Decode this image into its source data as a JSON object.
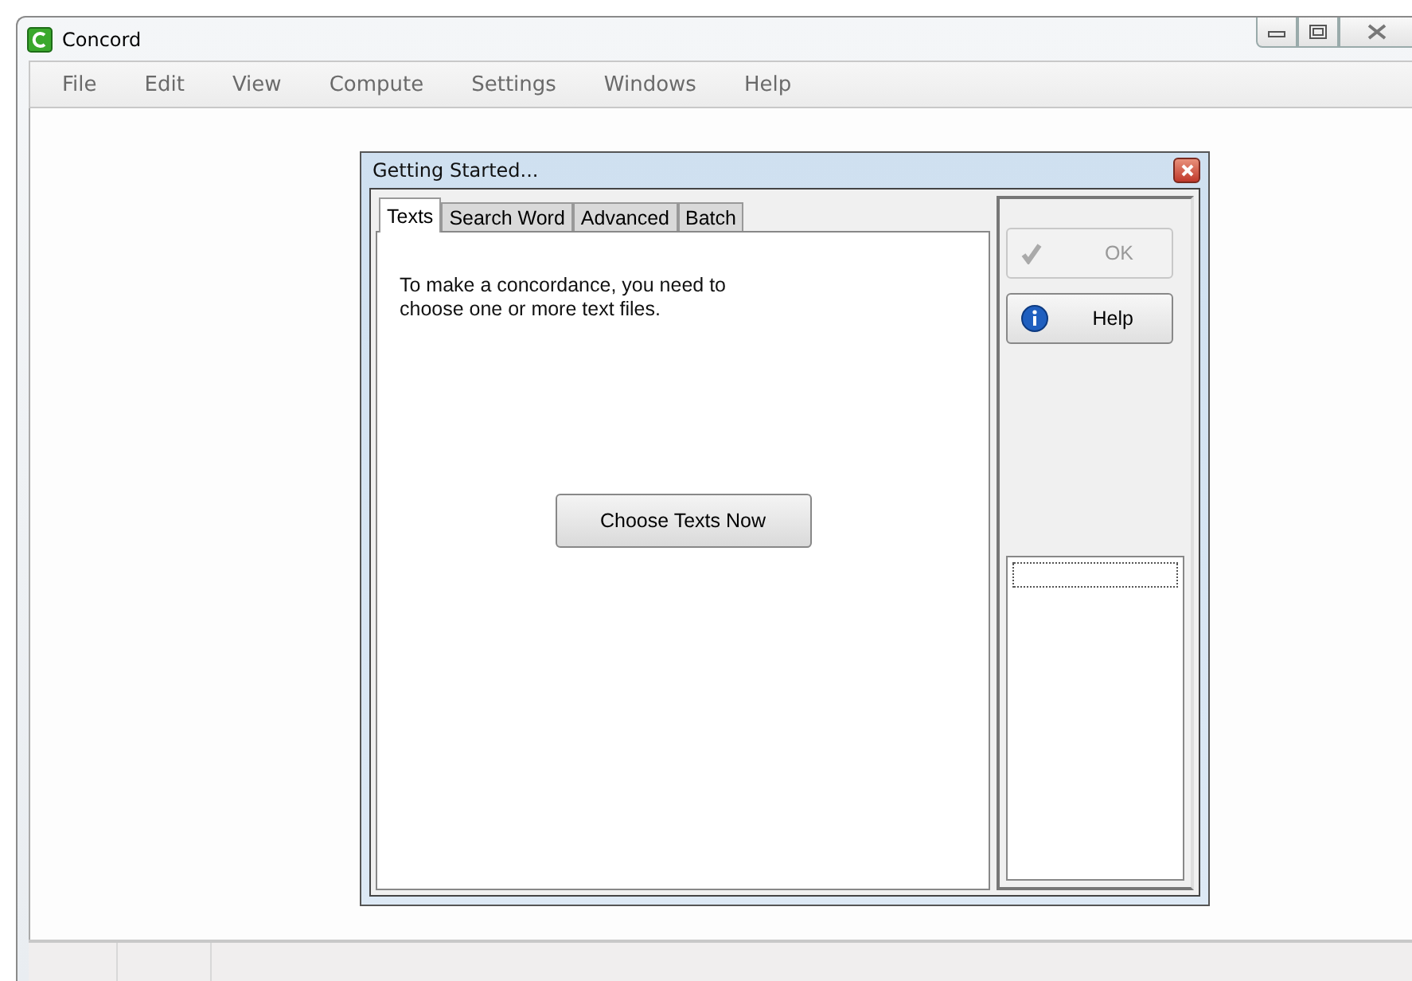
{
  "window": {
    "title": "Concord"
  },
  "menu": [
    "File",
    "Edit",
    "View",
    "Compute",
    "Settings",
    "Windows",
    "Help"
  ],
  "dialog": {
    "title": "Getting Started...",
    "tabs": [
      {
        "label": "Texts",
        "selected": true
      },
      {
        "label": "Search Word",
        "selected": false
      },
      {
        "label": "Advanced",
        "selected": false
      },
      {
        "label": "Batch",
        "selected": false
      }
    ],
    "message": "To make a concordance, you need to choose one or more text files.",
    "choose_button": "Choose Texts Now",
    "buttons": [
      {
        "kind": "ok",
        "label": "OK",
        "disabled": true
      },
      {
        "kind": "help",
        "label": "Help",
        "disabled": false
      }
    ]
  }
}
